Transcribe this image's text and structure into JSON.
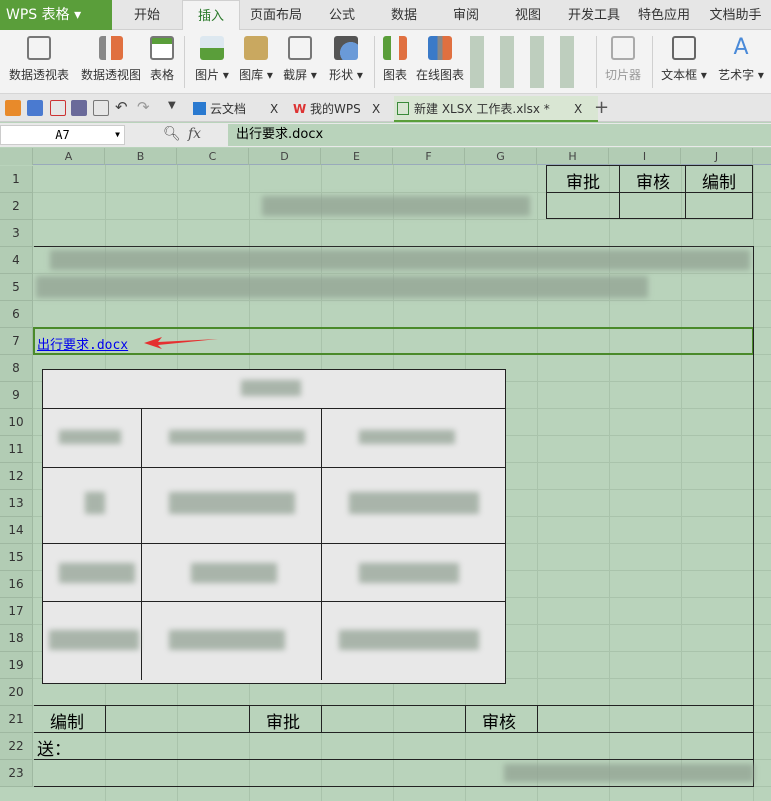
{
  "app": {
    "logo": "WPS 表格",
    "logo_arrow": "▾"
  },
  "ribbon_tabs": [
    "开始",
    "插入",
    "页面布局",
    "公式",
    "数据",
    "审阅",
    "视图",
    "开发工具",
    "特色应用",
    "文档助手"
  ],
  "active_tab": "插入",
  "ribbon_buttons": [
    "数据透视表",
    "数据透视图",
    "表格",
    "图片 ▾",
    "图库 ▾",
    "截屏 ▾",
    "形状 ▾",
    "图表",
    "在线图表",
    "切片器",
    "文本框 ▾",
    "艺术字 ▾"
  ],
  "doc_tabs": [
    {
      "label": "云文档",
      "close": "X"
    },
    {
      "label": "我的WPS",
      "close": "X"
    },
    {
      "label": "新建 XLSX 工作表.xlsx *",
      "close": "X"
    }
  ],
  "new_tab": "+",
  "formula_bar": {
    "name_box": "A7",
    "fx": "fx",
    "value": "出行要求.docx"
  },
  "columns": [
    "A",
    "B",
    "C",
    "D",
    "E",
    "F",
    "G",
    "H",
    "I",
    "J"
  ],
  "rows": [
    "1",
    "2",
    "3",
    "4",
    "5",
    "6",
    "7",
    "8",
    "9",
    "10",
    "11",
    "12",
    "13",
    "14",
    "15",
    "16",
    "17",
    "18",
    "19",
    "20",
    "21",
    "22",
    "23"
  ],
  "cells": {
    "h1": "审批",
    "i1": "审核",
    "j1": "编制",
    "a7": "出行要求.docx",
    "a21": "编制",
    "d21": "审批",
    "g21": "审核",
    "a22": "送："
  },
  "colors": {
    "sheet_bg": "#b9d3bb",
    "brand": "#5a9e3a",
    "link": "#0000ee",
    "arrow": "#e53030"
  }
}
